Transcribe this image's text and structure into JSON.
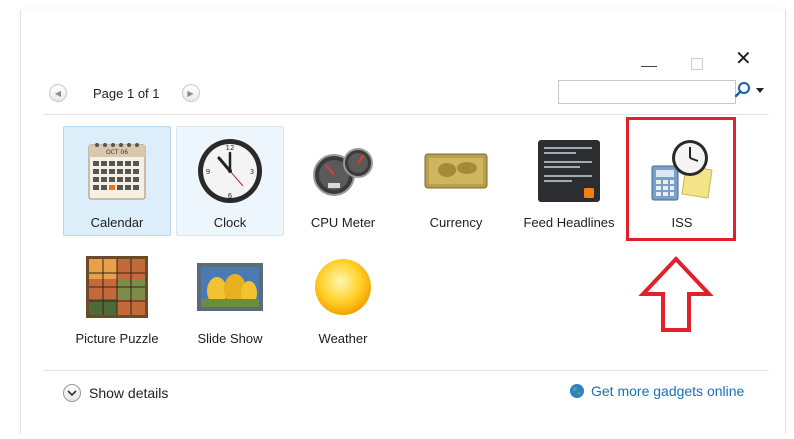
{
  "window": {
    "controls": {
      "minimize": "–",
      "maximize": "□",
      "close": "✕"
    }
  },
  "pager": {
    "text": "Page 1 of 1",
    "prev_icon": "chevron-left-icon",
    "next_icon": "chevron-right-icon"
  },
  "search": {
    "value": "",
    "placeholder": ""
  },
  "gadgets": [
    {
      "label": "Calendar",
      "state": "selected"
    },
    {
      "label": "Clock",
      "state": "hover"
    },
    {
      "label": "CPU Meter",
      "state": "normal"
    },
    {
      "label": "Currency",
      "state": "normal"
    },
    {
      "label": "Feed Headlines",
      "state": "normal"
    },
    {
      "label": "ISS",
      "state": "normal"
    },
    {
      "label": "Picture Puzzle",
      "state": "normal"
    },
    {
      "label": "Slide Show",
      "state": "normal"
    },
    {
      "label": "Weather",
      "state": "normal"
    }
  ],
  "calendar_icon": {
    "month": "OCT 06"
  },
  "footer": {
    "show_details": "Show details",
    "get_more": "Get more gadgets online"
  },
  "colors": {
    "highlight": "#e0202a",
    "link": "#1a6fb8",
    "selected_bg": "#ddeefb"
  }
}
